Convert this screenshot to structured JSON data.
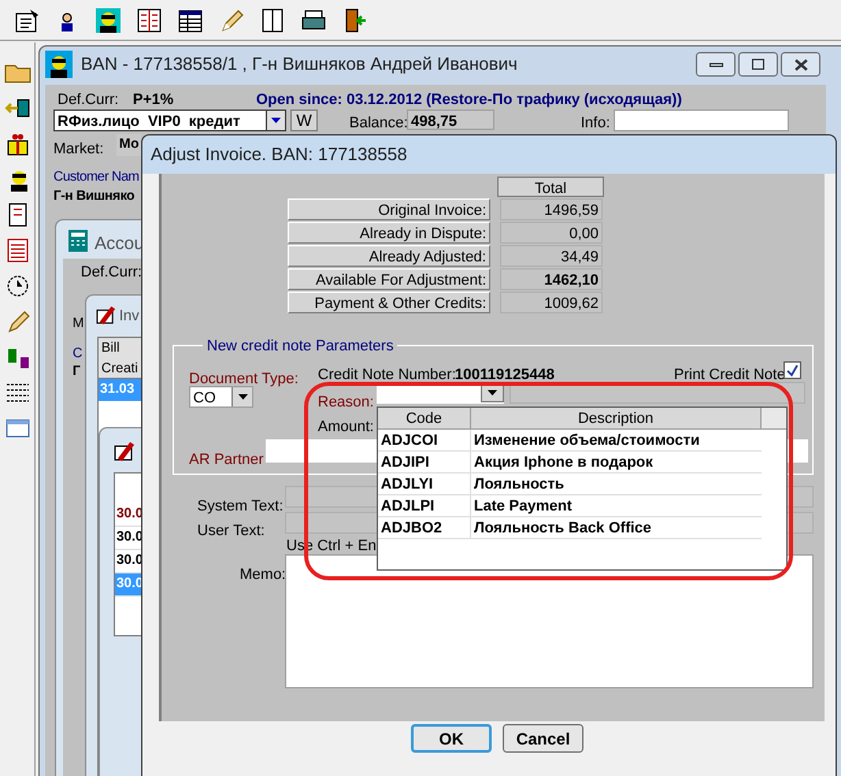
{
  "ban_window": {
    "title": "BAN - 177138558/1 , Г-н Вишняков Андрей Иванович",
    "def_curr_label": "Def.Curr:",
    "def_curr": "Р+1%",
    "open_since": "Open since: 03.12.2012 (Restore-По трафику (исходящая))",
    "plan": "RФиз.лицо  VIP0  кредит",
    "w_button": "W",
    "balance_label": "Balance:",
    "balance": "498,75",
    "info_label": "Info:",
    "market_label": "Market:",
    "market": "Mo",
    "customer_label": "Customer Nam",
    "customer": "Г-н Вишняко"
  },
  "account_window": {
    "title": "Accou",
    "def_curr_label": "Def.Curr:",
    "labels": [
      "M",
      "C",
      "Г"
    ]
  },
  "invoice_window": {
    "title": "Inv",
    "columns": [
      "Bill",
      "Creati"
    ],
    "rows": [
      {
        "text": "31.03",
        "selected": true
      }
    ]
  },
  "inner_window": {
    "rows": [
      {
        "text": "30.0",
        "color": "#800000",
        "selected": false
      },
      {
        "text": "30.0",
        "color": "#000000",
        "selected": false
      },
      {
        "text": "30.0",
        "color": "#000000",
        "selected": false
      },
      {
        "text": "30.0",
        "selected": true
      }
    ]
  },
  "dialog": {
    "title": "Adjust Invoice. BAN: 177138558",
    "total_header": "Total",
    "totals": [
      {
        "label": "Original Invoice:",
        "value": "1496,59",
        "bold": false
      },
      {
        "label": "Already in Dispute:",
        "value": "0,00",
        "bold": false
      },
      {
        "label": "Already Adjusted:",
        "value": "34,49",
        "bold": false
      },
      {
        "label": "Available For Adjustment:",
        "value": "1462,10",
        "bold": true
      },
      {
        "label": "Payment & Other Credits:",
        "value": "1009,62",
        "bold": false
      }
    ],
    "group_title": "New credit note Parameters",
    "document_type_label": "Document Type:",
    "document_type": "CO",
    "credit_note_label": "Credit Note Number:",
    "credit_note_number": "100119125448",
    "print_label": "Print Credit Note",
    "print_checked": true,
    "reason_label": "Reason:",
    "amount_label": "Amount:",
    "ar_partner_label": "AR Partner",
    "reason_list": {
      "columns": [
        "Code",
        "Description"
      ],
      "rows": [
        {
          "code": "ADJCOI",
          "description": "Изменение объема/стоимости"
        },
        {
          "code": "ADJIPI",
          "description": "Акция Iphone в подарок"
        },
        {
          "code": "ADJLYI",
          "description": "Лояльность"
        },
        {
          "code": "ADJLPI",
          "description": "Late Payment"
        },
        {
          "code": "ADJBO2",
          "description": "Лояльность Back Office"
        }
      ]
    },
    "system_text_label": "System Text:",
    "user_text_label": "User Text:",
    "hint": "Use Ctrl + En",
    "memo_label": "Memo:",
    "buttons": [
      {
        "label": "OK",
        "default": true
      },
      {
        "label": "Cancel",
        "default": false
      }
    ]
  }
}
